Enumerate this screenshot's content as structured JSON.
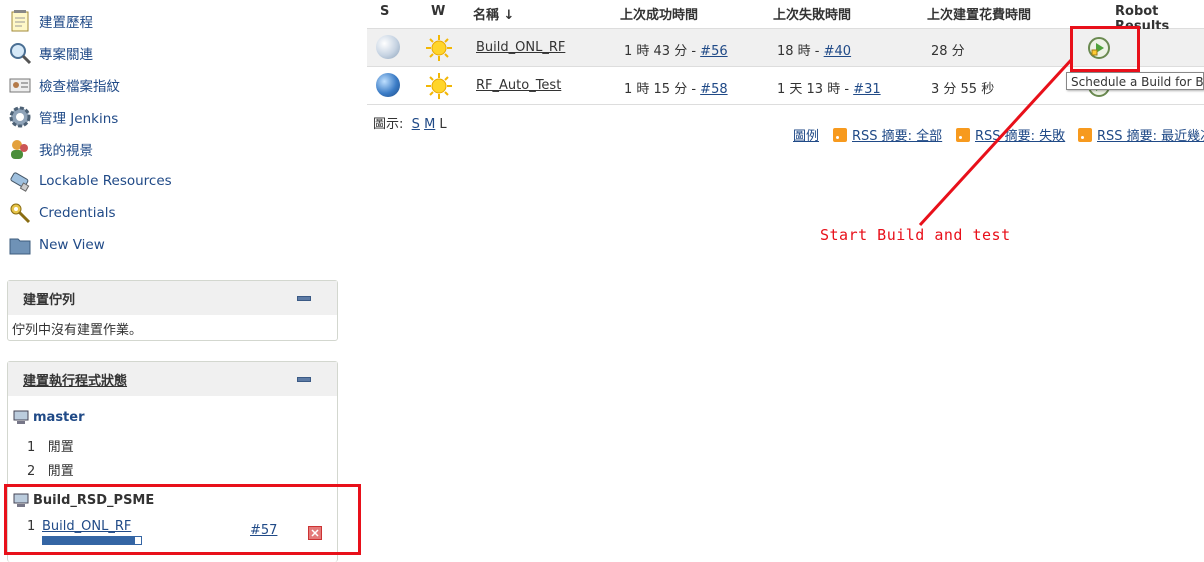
{
  "sidebar": {
    "tasks": [
      {
        "label": "建置歷程",
        "icon": "notepad-icon"
      },
      {
        "label": "專案關連",
        "icon": "search-icon"
      },
      {
        "label": "檢查檔案指紋",
        "icon": "fingerprint-icon"
      },
      {
        "label": "管理 Jenkins",
        "icon": "gear-icon"
      },
      {
        "label": "我的視景",
        "icon": "user-icon"
      },
      {
        "label": "Lockable Resources",
        "icon": "usb-icon"
      },
      {
        "label": "Credentials",
        "icon": "key-icon"
      },
      {
        "label": "New View",
        "icon": "folder-icon"
      }
    ],
    "build_queue": {
      "title": "建置佇列",
      "empty_text": "佇列中沒有建置作業。"
    },
    "executor_status": {
      "title": "建置執行程式狀態",
      "master": {
        "name": "master",
        "executors": [
          {
            "num": "1",
            "state": "閒置"
          },
          {
            "num": "2",
            "state": "閒置"
          }
        ]
      },
      "node": {
        "name": "Build_RSD_PSME",
        "executor_num": "1",
        "job": "Build_ONL_RF",
        "build": "#57",
        "progress": 0.94
      }
    }
  },
  "table": {
    "headers": {
      "s": "S",
      "w": "W",
      "name": "名稱 ↓",
      "last_success": "上次成功時間",
      "last_failure": "上次失敗時間",
      "last_duration": "上次建置花費時間",
      "robot": "Robot Results"
    },
    "rows": [
      {
        "name": "Build_ONL_RF",
        "success_time": "1 時 43 分 - ",
        "success_build": "#56",
        "failure_time": "18 時 - ",
        "failure_build": "#40",
        "duration": "28 分"
      },
      {
        "name": "RF_Auto_Test",
        "success_time": "1 時 15 分 - ",
        "success_build": "#58",
        "failure_time": "1 天 13 時 - ",
        "failure_build": "#31",
        "duration": "3 分 55 秒"
      }
    ]
  },
  "icon_size": {
    "label": "圖示:",
    "s": "S",
    "m": "M",
    "l": "L"
  },
  "links": {
    "legend": "圖例",
    "rss_all": "RSS 摘要: 全部",
    "rss_failed": "RSS 摘要: 失敗",
    "rss_latest": "RSS 摘要: 最近幾次"
  },
  "tooltip": "Schedule a Build for Build_ONL_RF",
  "annotation": {
    "text": "Start Build and test",
    "color": "#e8101a"
  }
}
